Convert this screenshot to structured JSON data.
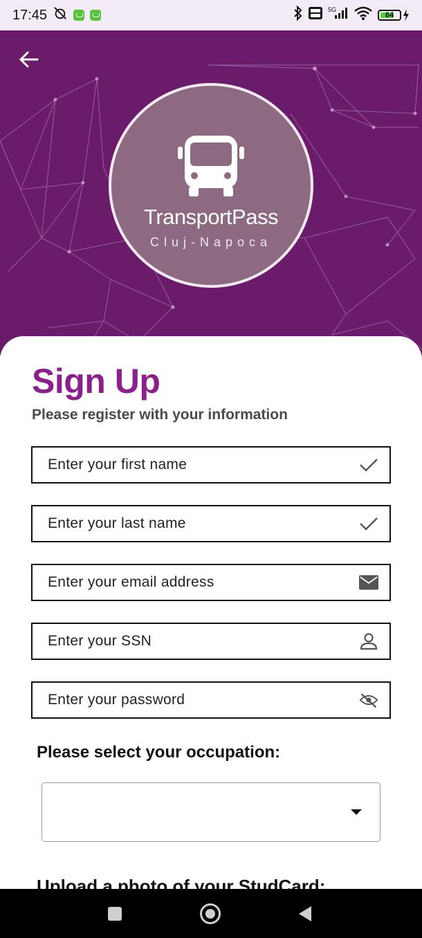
{
  "status_bar": {
    "time": "17:45",
    "battery_level": "64"
  },
  "header": {
    "brand_title": "TransportPass",
    "brand_subtitle": "Cluj-Napoca"
  },
  "form": {
    "title": "Sign Up",
    "subtitle": "Please register with your information",
    "fields": [
      {
        "placeholder": "Enter your first name",
        "icon": "check-icon"
      },
      {
        "placeholder": "Enter your last name",
        "icon": "check-icon"
      },
      {
        "placeholder": "Enter your email address",
        "icon": "mail-icon"
      },
      {
        "placeholder": "Enter your SSN",
        "icon": "person-icon"
      },
      {
        "placeholder": "Enter your password",
        "icon": "visibility-off-icon"
      }
    ],
    "occupation_label": "Please select your occupation:",
    "occupation_value": "",
    "upload_label": "Upload a photo of your StudCard:"
  },
  "colors": {
    "header_bg": "#6a1b6a",
    "accent": "#8b1f8b",
    "logo_circle": "#8d6a82"
  }
}
